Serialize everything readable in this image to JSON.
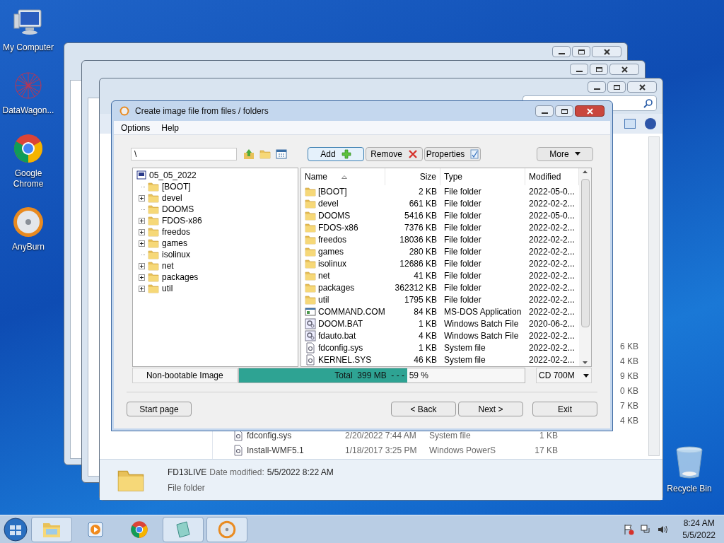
{
  "desktop_icons": [
    {
      "label": "My Computer",
      "kind": "computer"
    },
    {
      "label": "DataWagon...",
      "kind": "datawagon"
    },
    {
      "label": "Google Chrome",
      "kind": "chrome"
    },
    {
      "label": "AnyBurn",
      "kind": "anyburn"
    }
  ],
  "recycle_bin": {
    "label": "Recycle Bin"
  },
  "explorer": {
    "size_column": [
      "6 KB",
      "4 KB",
      "9 KB",
      "0 KB",
      "7 KB",
      "4 KB"
    ],
    "rows": [
      {
        "name": "fdconfig.sys",
        "modified": "2/20/2022 7:44 AM",
        "type": "System file",
        "size": "1 KB"
      },
      {
        "name": "Install-WMF5.1",
        "modified": "1/18/2017 3:25 PM",
        "type": "Windows PowerS",
        "size": "17 KB"
      }
    ],
    "details": {
      "name": "FD13LIVE",
      "date_label": "Date modified:",
      "date": "5/5/2022 8:22 AM",
      "type": "File folder"
    }
  },
  "dialog": {
    "title": "Create image file from files / folders",
    "menu": [
      "Options",
      "Help"
    ],
    "path": "\\",
    "buttons": {
      "add": "Add",
      "remove": "Remove",
      "properties": "Properties",
      "more": "More"
    },
    "tree": {
      "root": "05_05_2022",
      "children": [
        {
          "label": "[BOOT]",
          "expandable": false
        },
        {
          "label": "devel",
          "expandable": true
        },
        {
          "label": "DOOMS",
          "expandable": false
        },
        {
          "label": "FDOS-x86",
          "expandable": true
        },
        {
          "label": "freedos",
          "expandable": true
        },
        {
          "label": "games",
          "expandable": true
        },
        {
          "label": "isolinux",
          "expandable": false
        },
        {
          "label": "net",
          "expandable": true
        },
        {
          "label": "packages",
          "expandable": true
        },
        {
          "label": "util",
          "expandable": true
        }
      ]
    },
    "columns": [
      {
        "label": "Name",
        "sorted": true
      },
      {
        "label": "Size",
        "sorted": false
      },
      {
        "label": "Type",
        "sorted": false
      },
      {
        "label": "Modified",
        "sorted": false
      }
    ],
    "files": [
      {
        "name": "[BOOT]",
        "size": "2 KB",
        "type": "File folder",
        "modified": "2022-05-0...",
        "kind": "folder"
      },
      {
        "name": "devel",
        "size": "661 KB",
        "type": "File folder",
        "modified": "2022-02-2...",
        "kind": "folder"
      },
      {
        "name": "DOOMS",
        "size": "5416 KB",
        "type": "File folder",
        "modified": "2022-05-0...",
        "kind": "folder"
      },
      {
        "name": "FDOS-x86",
        "size": "7376 KB",
        "type": "File folder",
        "modified": "2022-02-2...",
        "kind": "folder"
      },
      {
        "name": "freedos",
        "size": "18036 KB",
        "type": "File folder",
        "modified": "2022-02-2...",
        "kind": "folder"
      },
      {
        "name": "games",
        "size": "280 KB",
        "type": "File folder",
        "modified": "2022-02-2...",
        "kind": "folder"
      },
      {
        "name": "isolinux",
        "size": "12686 KB",
        "type": "File folder",
        "modified": "2022-02-2...",
        "kind": "folder"
      },
      {
        "name": "net",
        "size": "41 KB",
        "type": "File folder",
        "modified": "2022-02-2...",
        "kind": "folder"
      },
      {
        "name": "packages",
        "size": "362312 KB",
        "type": "File folder",
        "modified": "2022-02-2...",
        "kind": "folder"
      },
      {
        "name": "util",
        "size": "1795 KB",
        "type": "File folder",
        "modified": "2022-02-2...",
        "kind": "folder"
      },
      {
        "name": "COMMAND.COM",
        "size": "84 KB",
        "type": "MS-DOS Application",
        "modified": "2022-02-2...",
        "kind": "app"
      },
      {
        "name": "DOOM.BAT",
        "size": "1 KB",
        "type": "Windows Batch File",
        "modified": "2020-06-2...",
        "kind": "batch"
      },
      {
        "name": "fdauto.bat",
        "size": "4 KB",
        "type": "Windows Batch File",
        "modified": "2022-02-2...",
        "kind": "batch"
      },
      {
        "name": "fdconfig.sys",
        "size": "1 KB",
        "type": "System file",
        "modified": "2022-02-2...",
        "kind": "system"
      },
      {
        "name": "KERNEL.SYS",
        "size": "46 KB",
        "type": "System file",
        "modified": "2022-02-2...",
        "kind": "system"
      }
    ],
    "status": {
      "label": "Non-bootable Image",
      "total": "Total  399 MB  - - -  59 %",
      "level": 0.59,
      "media": "CD 700M"
    },
    "nav": {
      "start": "Start page",
      "back": "< Back",
      "next": "Next >",
      "exit": "Exit"
    }
  },
  "taskbar": {
    "items": [
      {
        "kind": "explorer",
        "open": true
      },
      {
        "kind": "media",
        "open": false
      },
      {
        "kind": "chrome",
        "open": false
      },
      {
        "kind": "notepad",
        "open": true
      },
      {
        "kind": "anyburn",
        "open": true
      }
    ],
    "clock": {
      "time": "8:24 AM",
      "date": "5/5/2022"
    }
  }
}
